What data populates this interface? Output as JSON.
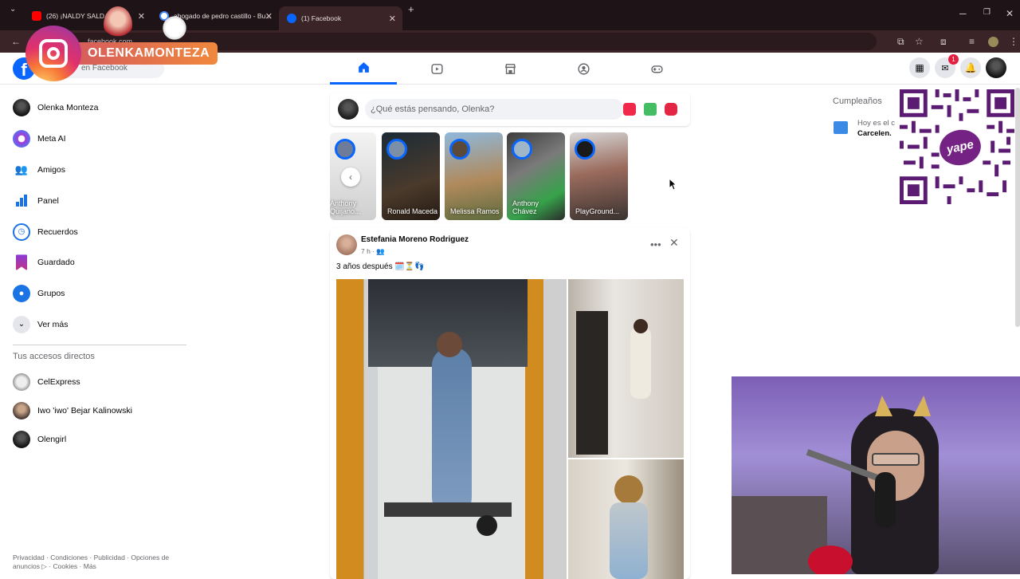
{
  "browser": {
    "tabs": [
      {
        "title": "(26) ¡NALDY SALDAÑA ...",
        "favicon_color": "#ff0000",
        "active": false
      },
      {
        "title": "abogado de pedro castillo - Bu...",
        "favicon_color": "#4285f4",
        "active": false
      },
      {
        "title": "(1) Facebook",
        "favicon_color": "#0866ff",
        "active": true
      }
    ],
    "new_tab": "+",
    "address": "facebook.com"
  },
  "overlay": {
    "instagram_handle": "OLENKAMONTEZA",
    "qr_brand": "yape"
  },
  "facebook": {
    "logo": "f",
    "search_placeholder": "en Facebook",
    "messenger_badge": "1",
    "sidebar": [
      {
        "label": "Olenka Monteza",
        "icon": "profile-avatar",
        "color": "#1c1c1c"
      },
      {
        "label": "Meta AI",
        "icon": "meta-ai-icon",
        "color": "#a33bd6"
      },
      {
        "label": "Amigos",
        "icon": "friends-icon",
        "color": "#1b74e4"
      },
      {
        "label": "Panel",
        "icon": "dashboard-icon",
        "color": "#1b74e4"
      },
      {
        "label": "Recuerdos",
        "icon": "memories-icon",
        "color": "#1b74e4"
      },
      {
        "label": "Guardado",
        "icon": "saved-icon",
        "color": "#8a3ad6"
      },
      {
        "label": "Grupos",
        "icon": "groups-icon",
        "color": "#1b74e4"
      },
      {
        "label": "Ver más",
        "icon": "chevron-down-icon",
        "color": "#e4e6eb"
      }
    ],
    "shortcuts_title": "Tus accesos directos",
    "shortcuts": [
      {
        "label": "CelExpress"
      },
      {
        "label": "Iwo 'iwo' Bejar Kalinowski"
      },
      {
        "label": "Olengirl"
      }
    ],
    "footer": "Privacidad · Condiciones · Publicidad · Opciones de anuncios ▷ · Cookies · Más",
    "composer_placeholder": "¿Qué estás pensando, Olenka?",
    "stories": [
      {
        "name": "Anthony Quijano..."
      },
      {
        "name": "Ronald Maceda"
      },
      {
        "name": "Melissa Ramos"
      },
      {
        "name": "Anthony Chávez"
      },
      {
        "name": "PlayGround..."
      }
    ],
    "post": {
      "author": "Estefania Moreno Rodriguez",
      "time": "7 h · 👥",
      "text": "3 años después 🗓️⏳👣"
    },
    "birthdays": {
      "title": "Cumpleaños",
      "text_line1": "Hoy es el c",
      "text_line2": "Carcelen."
    }
  }
}
